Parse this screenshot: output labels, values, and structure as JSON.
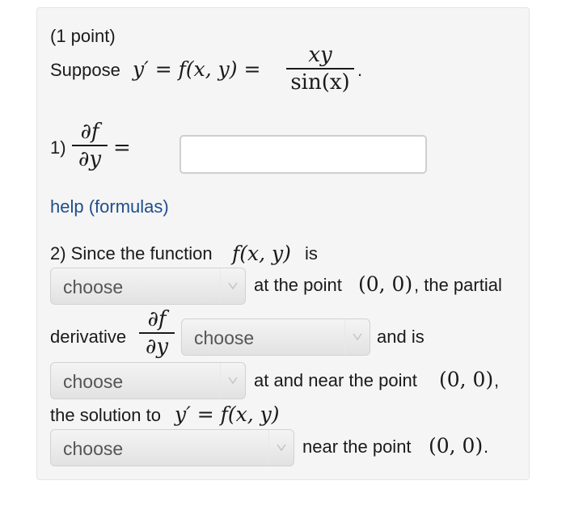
{
  "problem": {
    "points": "(1 point)",
    "suppose": "Suppose",
    "eq_lhs": "y′ = f(x, y) =",
    "frac_num": "xy",
    "frac_den": "sin(x)",
    "period": "."
  },
  "part1": {
    "label": "1)",
    "partial_num": "∂f",
    "partial_den": "∂y",
    "equals": "=",
    "answer_value": ""
  },
  "help_link": "help (formulas)",
  "part2": {
    "intro": "2) Since the function",
    "intro_math": "f(x, y)",
    "is": "is",
    "after_sel1": "at the point",
    "point1": "(0, 0)",
    "after_point1": ", the partial",
    "derivative": "derivative",
    "partial_num": "∂f",
    "partial_den": "∂y",
    "and_is": "and is",
    "after_sel3": "at and near the point",
    "point2": "(0, 0)",
    "comma": ",",
    "solution_text": "the solution to",
    "solution_math": "y′ = f(x, y)",
    "near_text": "near the point",
    "point3": "(0, 0)",
    "period": "."
  },
  "selects": {
    "s1": "choose",
    "s2": "choose",
    "s3": "choose",
    "s4": "choose"
  },
  "icons": {
    "dropdown": "chevron-down-icon"
  }
}
